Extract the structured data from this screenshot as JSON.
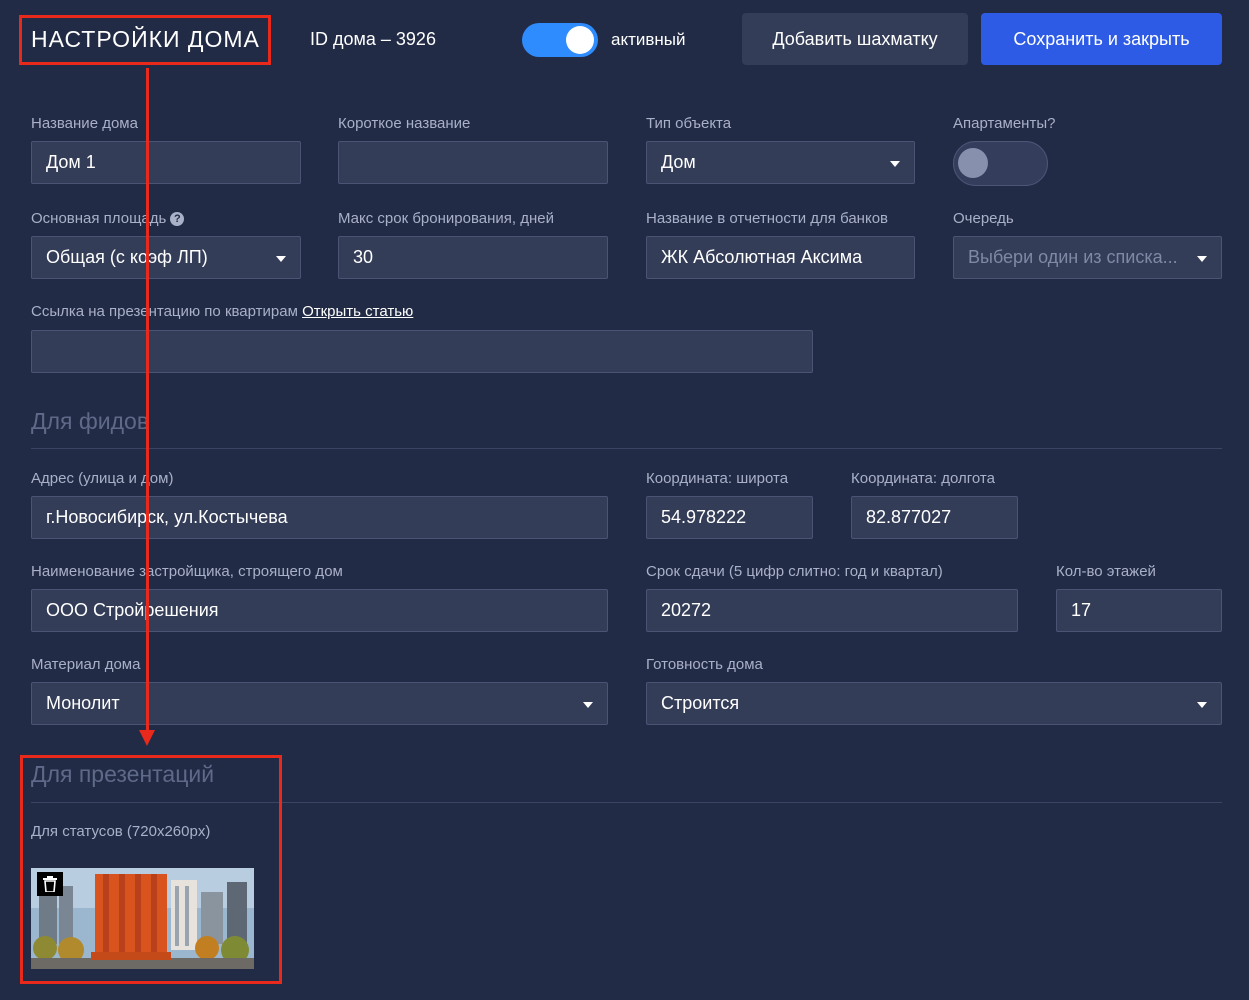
{
  "header": {
    "title": "НАСТРОЙКИ ДОМА",
    "house_id": "ID дома – 3926",
    "active_label": "активный",
    "add_chess_button": "Добавить шахматку",
    "save_close_button": "Сохранить и закрыть",
    "active_toggle": true
  },
  "form": {
    "house_name": {
      "label": "Название дома",
      "value": "Дом 1"
    },
    "short_name": {
      "label": "Короткое название",
      "value": ""
    },
    "object_type": {
      "label": "Тип объекта",
      "value": "Дом"
    },
    "apartments": {
      "label": "Апартаменты?",
      "enabled": false
    },
    "main_area": {
      "label": "Основная площадь",
      "help": "?",
      "value": "Общая (с коэф ЛП)"
    },
    "max_booking": {
      "label": "Макс срок бронирования, дней",
      "value": "30"
    },
    "bank_report_name": {
      "label": "Название в отчетности для банков",
      "value": "ЖК Абсолютная Аксима"
    },
    "queue": {
      "label": "Очередь",
      "placeholder": "Выбери один из списка..."
    },
    "presentation_link": {
      "label": "Ссылка на презентацию по квартирам",
      "link_text": "Открыть статью",
      "value": ""
    }
  },
  "feeds": {
    "section_title": "Для фидов",
    "address": {
      "label": "Адрес (улица и дом)",
      "value": "г.Новосибирск, ул.Костычева"
    },
    "latitude": {
      "label": "Координата: широта",
      "value": "54.978222"
    },
    "longitude": {
      "label": "Координата: долгота",
      "value": "82.877027"
    },
    "developer": {
      "label": "Наименование застройщика, строящего дом",
      "value": "ООО Стройрешения"
    },
    "deadline": {
      "label": "Срок сдачи (5 цифр слитно: год и квартал)",
      "value": "20272"
    },
    "floors": {
      "label": "Кол-во этажей",
      "value": "17"
    },
    "material": {
      "label": "Материал дома",
      "value": "Монолит"
    },
    "readiness": {
      "label": "Готовность дома",
      "value": "Строится"
    }
  },
  "presentations": {
    "section_title": "Для презентаций",
    "status_image_label": "Для статусов (720х260px)"
  },
  "colors": {
    "background": "#222b45",
    "field_bg": "#343d58",
    "primary": "#2e5be6",
    "toggle_on": "#2f8cff",
    "annotation": "#e8291c"
  },
  "icons": [
    "help-icon",
    "dropdown-caret-icon",
    "trash-icon"
  ]
}
